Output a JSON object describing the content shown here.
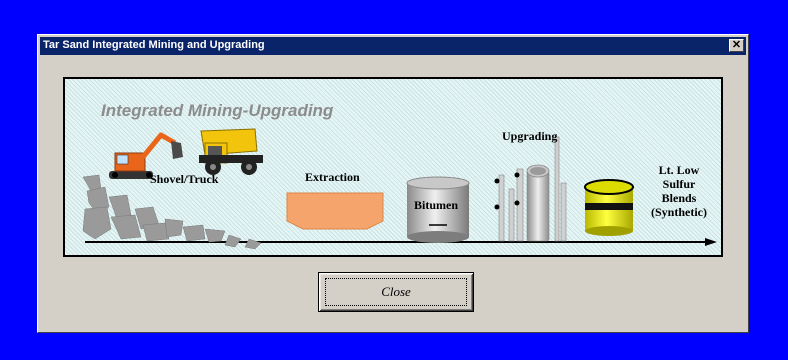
{
  "window": {
    "title": "Tar Sand Integrated Mining and Upgrading",
    "close_glyph": "✕"
  },
  "diagram": {
    "title": "Integrated Mining-Upgrading",
    "stages": {
      "mining": "Shovel/Truck",
      "extraction": "Extraction",
      "storage": "Bitumen",
      "upgrading": "Upgrading",
      "product_line1": "Lt. Low",
      "product_line2": "Sulfur",
      "product_line3": "Blends",
      "product_line4": "(Synthetic)"
    },
    "icons": [
      "excavator-icon",
      "dump-truck-icon",
      "rock-pile-icon",
      "extraction-vessel-icon",
      "bitumen-tank-icon",
      "upgrader-tower-icon",
      "product-drum-icon"
    ]
  },
  "buttons": {
    "close_label": "Close"
  },
  "colors": {
    "desktop": "#0000fe",
    "titlebar": "#0a246a",
    "dialog": "#d4d0c8",
    "extraction": "#f5a56b",
    "drum": "#f2f200"
  }
}
